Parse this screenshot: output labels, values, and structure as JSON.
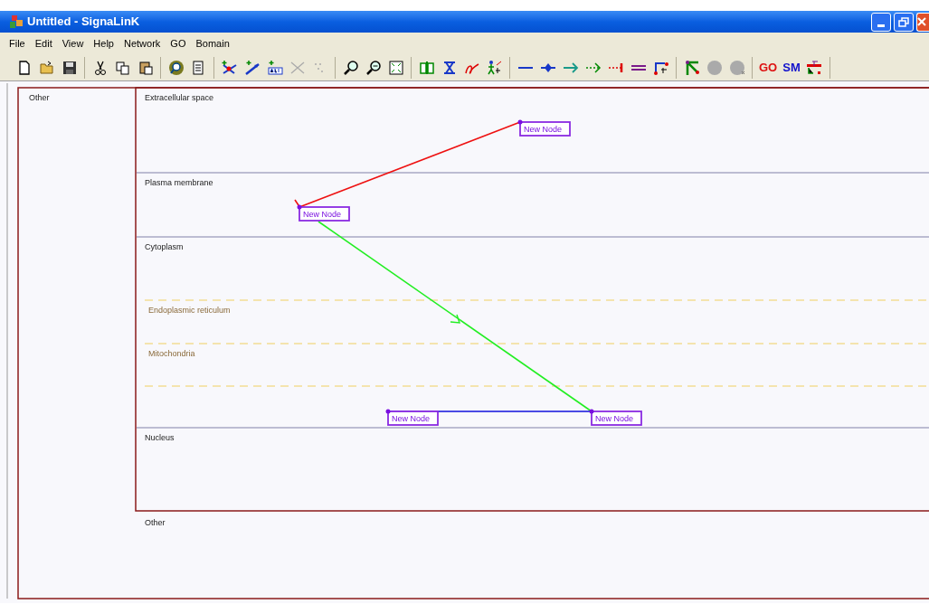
{
  "window": {
    "title": "Untitled - SignaLinK"
  },
  "menu": [
    "File",
    "Edit",
    "View",
    "Help",
    "Network",
    "GO",
    "Bomain"
  ],
  "toolbar": {
    "text_buttons": [
      {
        "label": "GO",
        "color": "#dd1111"
      },
      {
        "label": "SM",
        "color": "#1111cc"
      }
    ]
  },
  "canvas": {
    "outer_label": "Other",
    "compartments": [
      {
        "label": "Extracellular space",
        "kind": "membrane"
      },
      {
        "label": "Plasma membrane",
        "kind": "membrane"
      },
      {
        "label": "Cytoplasm",
        "kind": "membrane"
      },
      {
        "label": "Endoplasmic reticulum",
        "kind": "organelle"
      },
      {
        "label": "Mitochondria",
        "kind": "organelle"
      },
      {
        "label": "Nucleus",
        "kind": "membrane"
      }
    ],
    "bottom_label": "Other",
    "nodes": [
      {
        "label": "New Node"
      },
      {
        "label": "New Node"
      },
      {
        "label": "New Node"
      },
      {
        "label": "New Node"
      }
    ],
    "edges": [
      {
        "kind": "inhibition"
      },
      {
        "kind": "activation"
      },
      {
        "kind": "line"
      }
    ]
  }
}
